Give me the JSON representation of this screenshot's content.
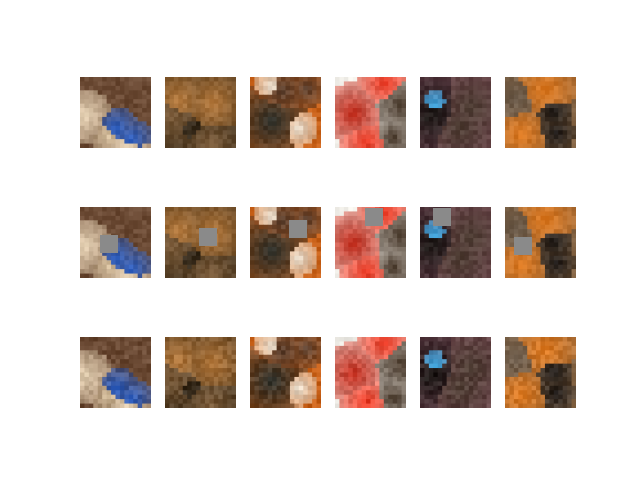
{
  "figure": {
    "background": "#ffffff",
    "layout": {
      "rows": 3,
      "cols": 6
    },
    "row_roles": [
      "original",
      "masked-with-gray-patch",
      "reconstructed"
    ],
    "mask_color": "#8a8a8a",
    "subjects": [
      {
        "name": "cream-dog-with-blue-toy",
        "palette": [
          "#6b4a34",
          "#e6d2b4",
          "#2f62c7",
          "#d8c2a0"
        ]
      },
      {
        "name": "tabby-cat-dark-background",
        "palette": [
          "#2b2418",
          "#b67a3d",
          "#7a5a38",
          "#3a2d1d"
        ]
      },
      {
        "name": "siamese-cat-on-orange-blanket",
        "palette": [
          "#c9621a",
          "#e8e0d2",
          "#5a4030",
          "#2a2e2a"
        ]
      },
      {
        "name": "dark-kitten-on-red-blanket",
        "palette": [
          "#f2f0ea",
          "#e8341e",
          "#4a3a2c",
          "#c02818"
        ]
      },
      {
        "name": "black-puppy-held-in-hands",
        "palette": [
          "#7a4a58",
          "#4e3e34",
          "#1e1a18",
          "#3aa0d8"
        ]
      },
      {
        "name": "black-dog-with-orange-ball",
        "palette": [
          "#8a6a4a",
          "#1e1a18",
          "#e07a20",
          "#6a5a4a"
        ]
      }
    ],
    "mask_patch_fraction": [
      {
        "col": 0.28,
        "row": 0.4
      },
      {
        "col": 0.48,
        "row": 0.3
      },
      {
        "col": 0.55,
        "row": 0.18
      },
      {
        "col": 0.42,
        "row": 0.02
      },
      {
        "col": 0.18,
        "row": 0.02
      },
      {
        "col": 0.12,
        "row": 0.42
      }
    ]
  }
}
